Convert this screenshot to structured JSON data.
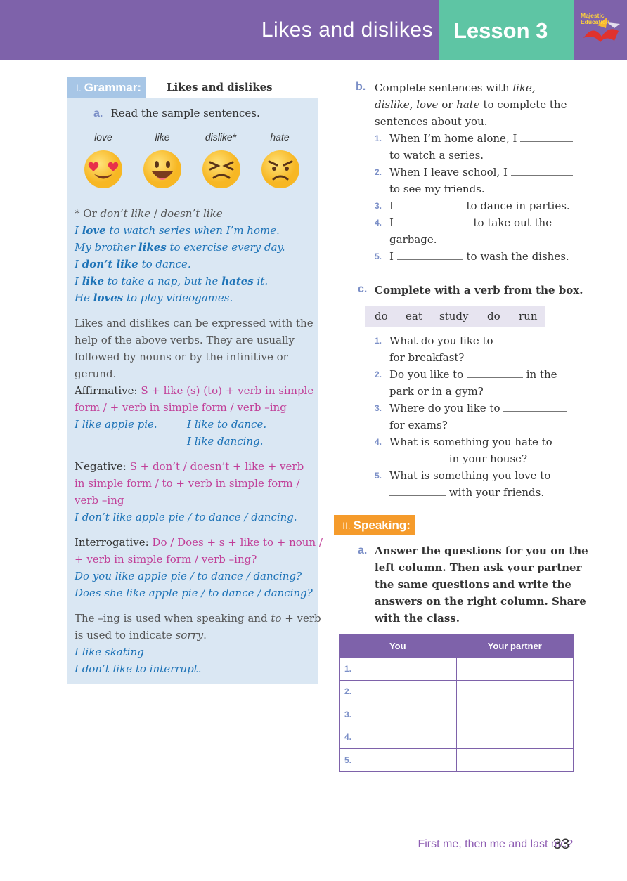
{
  "header": {
    "title": "Likes and dislikes",
    "lesson": "Lesson 3",
    "logo_text_1": "Majestic",
    "logo_text_2": "Education",
    "colors": {
      "bar": "#7e62aa",
      "lesson_box": "#5ec5a4"
    }
  },
  "grammar": {
    "number": "I.",
    "tag": "Grammar:",
    "title": "Likes and dislikes",
    "a_letter": "a.",
    "a_instruction": "Read the sample sentences.",
    "emojis": [
      {
        "label": "love",
        "icon": "heart-eyes-emoji-icon"
      },
      {
        "label": "like",
        "icon": "grinning-emoji-icon"
      },
      {
        "label": "dislike*",
        "icon": "squinting-emoji-icon"
      },
      {
        "label": "hate",
        "icon": "angry-emoji-icon"
      }
    ],
    "note_prefix": "* Or",
    "note_a": "don’t like",
    "note_sep": "/",
    "note_b": "doesn’t like",
    "examples": [
      {
        "pre": "I",
        "bold": "love",
        "post": "to watch series when I’m home."
      },
      {
        "pre": "My brother",
        "bold": "likes",
        "post": "to exercise every day."
      },
      {
        "pre": "I",
        "bold": "don’t like",
        "post": "to dance."
      },
      {
        "pre": "I",
        "bold": "like",
        "mid": "to take a nap, but he",
        "bold2": "hates",
        "post": "it."
      },
      {
        "pre": "He",
        "bold": "loves",
        "post": "to play videogames."
      }
    ],
    "explanation": [
      "Likes and dislikes can be expressed with the",
      "help of the above verbs. They are usually",
      "followed by nouns or by the infinitive or",
      "gerund."
    ],
    "affirmative_label": "Affirmative:",
    "affirmative_rule_1": "S + like (s) (to) + verb in simple",
    "affirmative_rule_2": "form / + verb in simple form / verb –ing",
    "affirmative_ex_1": "I like apple pie.",
    "affirmative_ex_2": "I like to dance.",
    "affirmative_ex_3": "I like dancing.",
    "negative_label": "Negative:",
    "negative_rule_1": "S + don’t / doesn’t + like + verb",
    "negative_rule_2": "in simple form / to + verb in simple form /",
    "negative_rule_3": "verb –ing",
    "negative_ex": "I don’t like apple pie / to dance / dancing.",
    "interrogative_label": "Interrogative:",
    "interrogative_rule_1": "Do / Does + s + like to + noun /",
    "interrogative_rule_2": "+ verb in simple form / verb –ing?",
    "interrogative_ex_1": "Do you like apple pie / to dance / dancing?",
    "interrogative_ex_2": "Does she like apple pie / to dance / dancing?",
    "ing_note_1a": "The –ing is used when speaking and",
    "ing_note_1b": "to",
    "ing_note_1c": "+ verb",
    "ing_note_2a": "is used to indicate",
    "ing_note_2b": "sorry",
    "ing_note_2c": ".",
    "final_ex_1": "I like skating",
    "final_ex_2": "I don’t like to interrupt."
  },
  "exercise_b": {
    "letter": "b.",
    "line1_pre": "Complete sentences with",
    "line1_it": "like,",
    "line2_it1": "dislike,",
    "line2_it2": "love",
    "line2_mid": "or",
    "line2_it3": "hate",
    "line2_post": "to complete the",
    "line3": "sentences about you.",
    "items": [
      {
        "num": "1.",
        "a": "When I’m home alone, I",
        "b": "to watch a series."
      },
      {
        "num": "2.",
        "a": "When I leave school, I",
        "b": "to see my friends."
      },
      {
        "num": "3.",
        "a": "I",
        "b": "to dance in parties."
      },
      {
        "num": "4.",
        "a": "I",
        "b": "to take out the",
        "c": "garbage."
      },
      {
        "num": "5.",
        "a": "I",
        "b": "to wash the dishes."
      }
    ]
  },
  "exercise_c": {
    "letter": "c.",
    "instruction": "Complete with a verb from the box.",
    "verbs": [
      "do",
      "eat",
      "study",
      "do",
      "run"
    ],
    "items": [
      {
        "num": "1.",
        "a": "What do you like to",
        "b": "for breakfast?"
      },
      {
        "num": "2.",
        "a": "Do you like to",
        "a2": "in the",
        "b": "park or in a gym?"
      },
      {
        "num": "3.",
        "a": "Where do you like to",
        "b": "for exams?"
      },
      {
        "num": "4.",
        "a": "What is something you hate to",
        "b": "in your house?"
      },
      {
        "num": "5.",
        "a": "What is something you love to",
        "b": "with your friends."
      }
    ]
  },
  "speaking": {
    "number": "II.",
    "tag": "Speaking:",
    "a_letter": "a.",
    "a_lines": [
      "Answer the questions for you on the",
      "left column. Then ask your partner",
      "the same questions and write the",
      "answers on the right column. Share",
      "with the class."
    ],
    "table": {
      "headers": [
        "You",
        "Your partner"
      ],
      "rows": [
        "1.",
        "2.",
        "3.",
        "4.",
        "5."
      ]
    }
  },
  "footer": {
    "text": "First me, then me and last me?",
    "page": "33"
  }
}
